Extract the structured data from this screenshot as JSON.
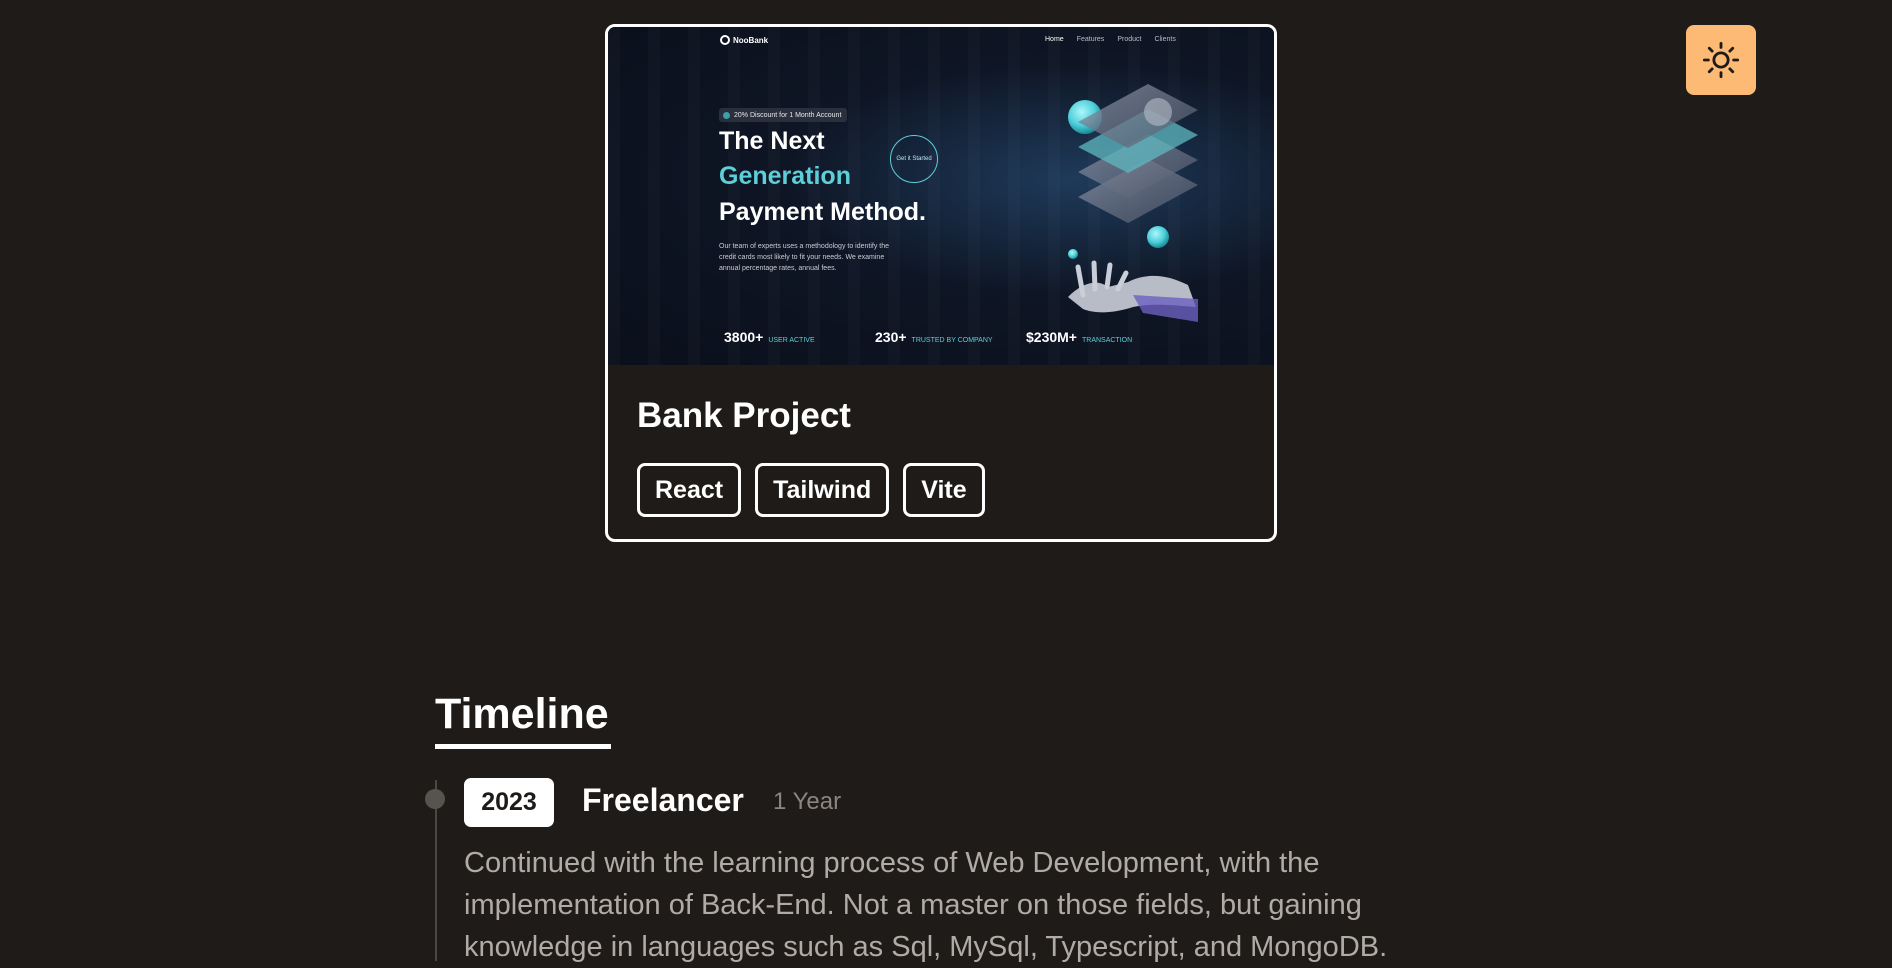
{
  "theme_toggle": {
    "icon": "sun-icon",
    "bg_color": "#fdba74"
  },
  "project": {
    "title": "Bank Project",
    "tags": [
      "React",
      "Tailwind",
      "Vite"
    ],
    "preview": {
      "logo": "NooBank",
      "nav": [
        "Home",
        "Features",
        "Product",
        "Clients"
      ],
      "badge": "20% Discount for 1 Month Account",
      "headline_1": "The Next",
      "headline_2": "Generation",
      "headline_3": "Payment Method.",
      "description": "Our team of experts uses a methodology to identify the credit cards most likely to fit your needs. We examine annual percentage rates, annual fees.",
      "cta": "Get it Started",
      "stats": [
        {
          "value": "3800+",
          "label": "USER ACTIVE"
        },
        {
          "value": "230+",
          "label": "TRUSTED BY COMPANY"
        },
        {
          "value": "$230M+",
          "label": "TRANSACTION"
        }
      ]
    }
  },
  "timeline": {
    "title": "Timeline",
    "items": [
      {
        "year": "2023",
        "role": "Freelancer",
        "duration": "1 Year",
        "description": "Continued with the learning process of Web Development, with the implementation of Back-End. Not a master on those fields, but gaining knowledge in languages such as Sql, MySql, Typescript, and MongoDB."
      }
    ]
  }
}
